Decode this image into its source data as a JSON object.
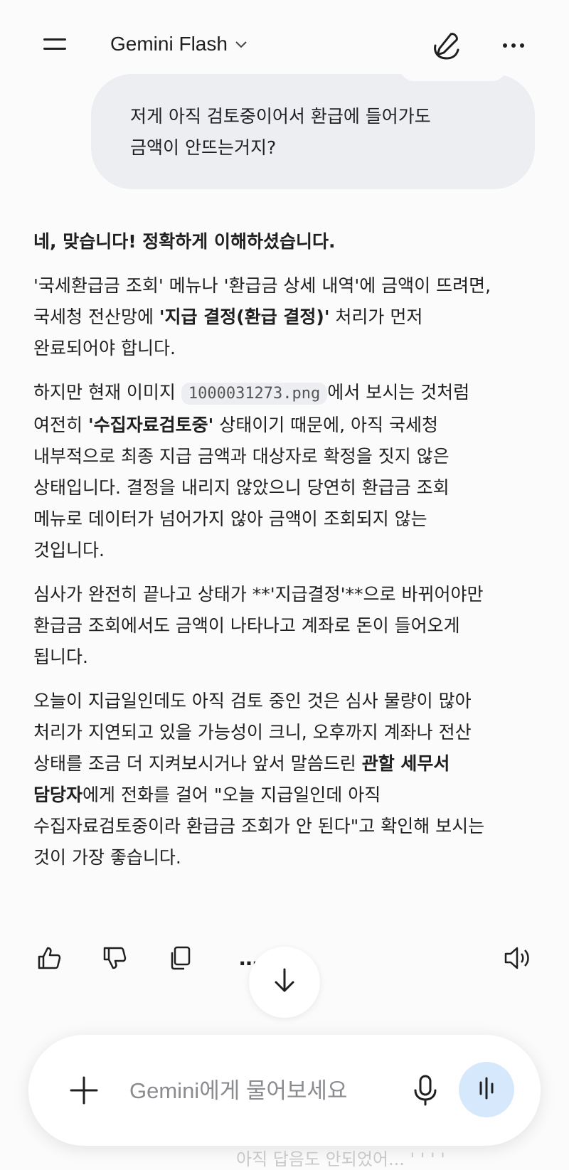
{
  "header": {
    "model_name": "Gemini Flash",
    "menu_icon": "hamburger-menu-icon",
    "edit_icon": "new-chat-pen-icon",
    "more_icon": "more-horizontal-icon"
  },
  "user_message": {
    "line1": "저게 아직 검토중이어서 환급에 들어가도",
    "line2": "금액이 안뜨는거지?"
  },
  "response": {
    "p1_bold": "네, 맞습니다! 정확하게 이해하셨습니다.",
    "p2_a": "'국세환급금 조회' 메뉴나 '환급금 상세 내역'에 금액이 뜨려면,",
    "p2_b": "국세청 전산망에 ",
    "p2_bold": "'지급 결정(환급 결정)'",
    "p2_c": " 처리가 먼저",
    "p2_d": "완료되어야 합니다.",
    "p3_a": "하지만 현재 이미지 ",
    "p3_code": "1000031273.png",
    "p3_b": "에서 보시는 것처럼",
    "p3_c": "여전히 ",
    "p3_bold": "'수집자료검토중'",
    "p3_d": " 상태이기 때문에, 아직 국세청",
    "p3_e": "내부적으로 최종 지급 금액과 대상자로 확정을 짓지 않은",
    "p3_f": "상태입니다. 결정을 내리지 않았으니 당연히 환급금 조회",
    "p3_g": "메뉴로 데이터가 넘어가지 않아 금액이 조회되지 않는",
    "p3_h": "것입니다.",
    "p4_a": "심사가 완전히 끝나고 상태가 **'지급결정'**으로 바뀌어야만",
    "p4_b": "환급금 조회에서도 금액이 나타나고 계좌로 돈이 들어오게",
    "p4_c": "됩니다.",
    "p5_a": "오늘이 지급일인데도 아직 검토 중인 것은 심사 물량이 많아",
    "p5_b": "처리가 지연되고 있을 가능성이 크니, 오후까지 계좌나 전산",
    "p5_c": "상태를 조금 더 지켜보시거나 앞서 말씀드린 ",
    "p5_bold1": "관할 세무서",
    "p5_bold2": "담당자",
    "p5_d": "에게 전화를 걸어 \"오늘 지급일인데 아직",
    "p5_e": "수집자료검토중이라 환급금 조회가 안 된다\"고 확인해 보시는",
    "p5_f": "것이 가장 좋습니다."
  },
  "actions": {
    "like_icon": "thumbs-up-icon",
    "dislike_icon": "thumbs-down-icon",
    "copy_icon": "copy-icon",
    "more_icon": "more-horizontal-icon",
    "speak_icon": "speaker-icon",
    "scroll_icon": "arrow-down-icon",
    "more_label": "…"
  },
  "input": {
    "placeholder": "Gemini에게 물어보세요",
    "plus_icon": "plus-icon",
    "mic_icon": "microphone-icon",
    "voice_icon": "live-voice-icon"
  },
  "ghost_text": "아직 답음도 안되었어... ' ' ' '",
  "colors": {
    "background": "#fbfbfc",
    "bubble": "#eceef1",
    "voice_button": "#d6e8fc",
    "text": "#1f1f1f"
  }
}
